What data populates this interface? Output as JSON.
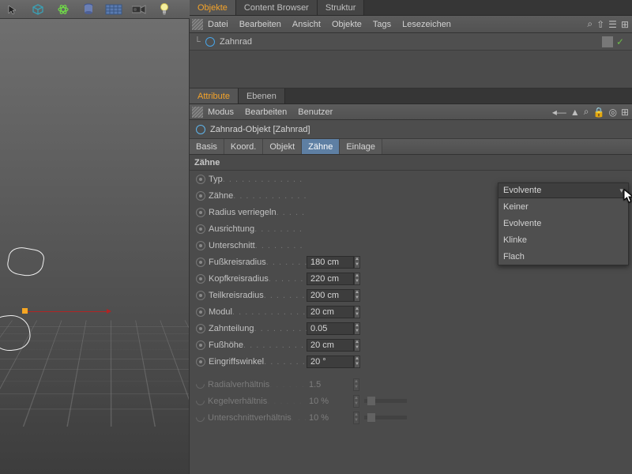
{
  "objects_panel": {
    "tabs": [
      "Objekte",
      "Content Browser",
      "Struktur"
    ],
    "menu": [
      "Datei",
      "Bearbeiten",
      "Ansicht",
      "Objekte",
      "Tags",
      "Lesezeichen"
    ],
    "tree": {
      "item": "Zahnrad"
    }
  },
  "attr_panel": {
    "tabs": [
      "Attribute",
      "Ebenen"
    ],
    "menu": [
      "Modus",
      "Bearbeiten",
      "Benutzer"
    ],
    "title": "Zahnrad-Objekt [Zahnrad]",
    "param_tabs": [
      "Basis",
      "Koord.",
      "Objekt",
      "Zähne",
      "Einlage"
    ],
    "section_header": "Zähne"
  },
  "dropdown": {
    "selected": "Evolvente",
    "options": [
      "Keiner",
      "Evolvente",
      "Klinke",
      "Flach"
    ]
  },
  "params": [
    {
      "label": "Typ",
      "kind": "dd",
      "radio": true
    },
    {
      "label": "Zähne",
      "radio": true
    },
    {
      "label": "Radius verriegeln",
      "radio": true
    },
    {
      "label": "Ausrichtung",
      "radio": true
    },
    {
      "label": "Unterschnitt",
      "radio": true
    },
    {
      "label": "Fußkreisradius",
      "value": "180 cm",
      "radio": true,
      "spin": true
    },
    {
      "label": "Kopfkreisradius",
      "value": "220 cm",
      "radio": true,
      "spin": true
    },
    {
      "label": "Teilkreisradius",
      "value": "200 cm",
      "radio": true,
      "spin": true
    },
    {
      "label": "Modul",
      "value": "20 cm",
      "radio": true,
      "spin": true
    },
    {
      "label": "Zahnteilung",
      "value": "0.05",
      "radio": true,
      "spin": true
    },
    {
      "label": "Fußhöhe",
      "value": "20 cm",
      "radio": true,
      "spin": true
    },
    {
      "label": "Eingriffswinkel",
      "value": "20 °",
      "radio": true,
      "spin": true
    },
    {
      "label": "Radialverhältnis",
      "value": "1.5",
      "dim": true,
      "spin": true
    },
    {
      "label": "Kegelverhältnis",
      "value": "10 %",
      "dim": true,
      "spin": true,
      "slider": true
    },
    {
      "label": "Unterschnittverhältnis",
      "value": "10 %",
      "dim": true,
      "spin": true,
      "slider": true
    }
  ]
}
